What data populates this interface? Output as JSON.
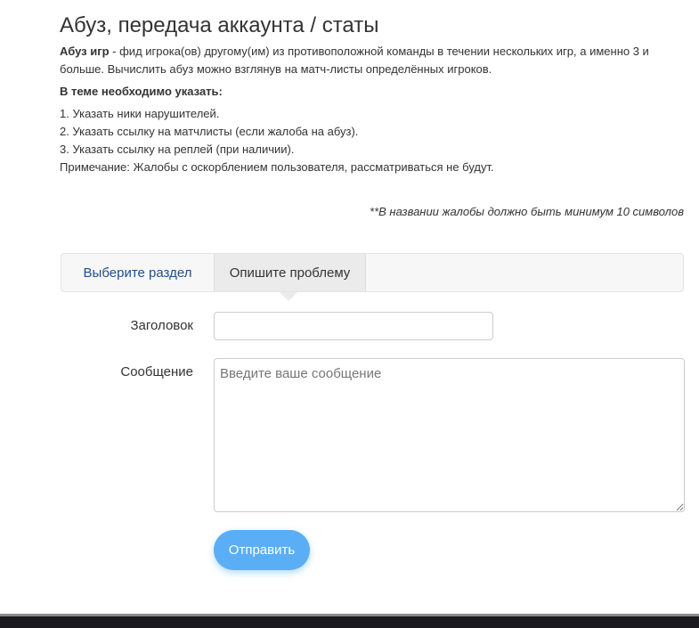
{
  "header": {
    "title": "Абуз, передача аккаунта / статы"
  },
  "description": {
    "term": "Абуз игр",
    "text": " - фид игрока(ов) другому(им) из противоположной команды в течении нескольких игр, а именно 3 и больше. Вычислить абуз можно взглянув на матч-листы определённых игроков."
  },
  "requirements": {
    "heading": "В теме необходимо указать:",
    "items": [
      "1. Указать ники нарушителей.",
      "2. Указать ссылку на матчлисты (если жалоба на абуз).",
      "3. Указать ссылку на реплей (при наличии).",
      "Примечание: Жалобы с оскорблением пользователя, рассматриваться не будут."
    ]
  },
  "note": "**В названии жалобы должно быть минимум 10 символов",
  "tabs": {
    "select_section": "Выберите раздел",
    "describe_problem": "Опишите проблему"
  },
  "form": {
    "title_label": "Заголовок",
    "title_value": "",
    "message_label": "Сообщение",
    "message_placeholder": "Введите ваше сообщение",
    "submit_label": "Отправить"
  },
  "colors": {
    "accent": "#5aaef5",
    "link": "#1f4e8c"
  }
}
